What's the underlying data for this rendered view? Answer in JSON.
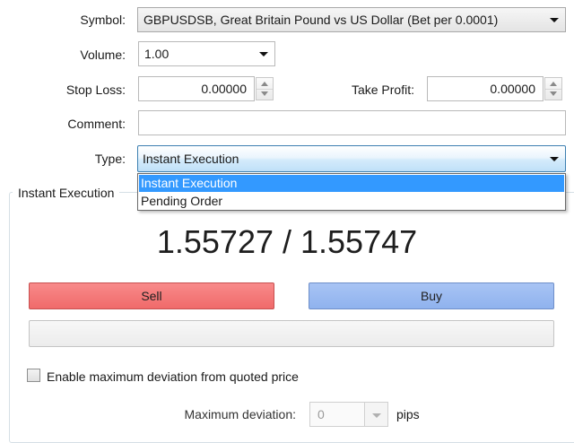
{
  "form": {
    "symbol_label": "Symbol:",
    "symbol_value": "GBPUSDSB, Great Britain Pound vs US Dollar  (Bet per 0.0001)",
    "volume_label": "Volume:",
    "volume_value": "1.00",
    "stop_loss_label": "Stop Loss:",
    "stop_loss_value": "0.00000",
    "take_profit_label": "Take Profit:",
    "take_profit_value": "0.00000",
    "comment_label": "Comment:",
    "comment_value": "",
    "type_label": "Type:",
    "type_value": "Instant Execution",
    "type_options": [
      "Instant Execution",
      "Pending Order"
    ]
  },
  "execution": {
    "group_title": "Instant Execution",
    "price": "1.55727 / 1.55747",
    "sell_label": "Sell",
    "buy_label": "Buy",
    "status_text": "",
    "deviation_checkbox_label": "Enable maximum deviation from quoted price",
    "deviation_checked": false,
    "max_deviation_label": "Maximum deviation:",
    "max_deviation_value": "0",
    "max_deviation_unit": "pips"
  },
  "colors": {
    "sell": "#f06a6a",
    "buy": "#8fb2ee",
    "selection": "#3399ff"
  }
}
